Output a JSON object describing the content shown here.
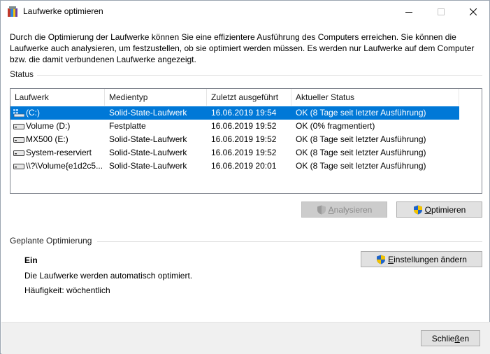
{
  "window": {
    "title": "Laufwerke optimieren",
    "icon": "defrag-app-icon"
  },
  "intro": {
    "text": "Durch die Optimierung der Laufwerke können Sie eine effizientere Ausführung des Computers erreichen. Sie können die Laufwerke auch analysieren, um festzustellen, ob sie optimiert werden müssen. Es werden nur Laufwerke auf dem Computer bzw. die damit verbundenen Laufwerke angezeigt."
  },
  "status": {
    "label": "Status",
    "columns": [
      "Laufwerk",
      "Medientyp",
      "Zuletzt ausgeführt",
      "Aktueller Status"
    ],
    "rows": [
      {
        "drive": "(C:)",
        "media": "Solid-State-Laufwerk",
        "last_run": "16.06.2019 19:54",
        "status": "OK (8 Tage seit letzter Ausführung)",
        "icon": "system-drive-icon",
        "selected": true
      },
      {
        "drive": "Volume (D:)",
        "media": "Festplatte",
        "last_run": "16.06.2019 19:52",
        "status": "OK (0% fragmentiert)",
        "icon": "drive-icon",
        "selected": false
      },
      {
        "drive": "MX500 (E:)",
        "media": "Solid-State-Laufwerk",
        "last_run": "16.06.2019 19:52",
        "status": "OK (8 Tage seit letzter Ausführung)",
        "icon": "drive-icon",
        "selected": false
      },
      {
        "drive": "System-reserviert",
        "media": "Solid-State-Laufwerk",
        "last_run": "16.06.2019 19:52",
        "status": "OK (8 Tage seit letzter Ausführung)",
        "icon": "drive-icon",
        "selected": false
      },
      {
        "drive": "\\\\?\\Volume{e1d2c5...",
        "media": "Solid-State-Laufwerk",
        "last_run": "16.06.2019 20:01",
        "status": "OK (8 Tage seit letzter Ausführung)",
        "icon": "drive-icon",
        "selected": false
      }
    ],
    "analyze_button": {
      "mnemonic": "A",
      "rest": "nalysieren",
      "enabled": false
    },
    "optimize_button": {
      "mnemonic": "O",
      "rest": "ptimieren",
      "enabled": true
    }
  },
  "schedule": {
    "label": "Geplante Optimierung",
    "state": "Ein",
    "description": "Die Laufwerke werden automatisch optimiert.",
    "frequency": "Häufigkeit: wöchentlich",
    "settings_button": {
      "mnemonic": "E",
      "rest": "instellungen ändern"
    }
  },
  "footer": {
    "close_button": {
      "before": "Schlie",
      "mnemonic": "ß",
      "after": "en"
    }
  },
  "colors": {
    "selection": "#0078d7",
    "shield_blue": "#1e63c8",
    "shield_yellow": "#f2c200"
  }
}
